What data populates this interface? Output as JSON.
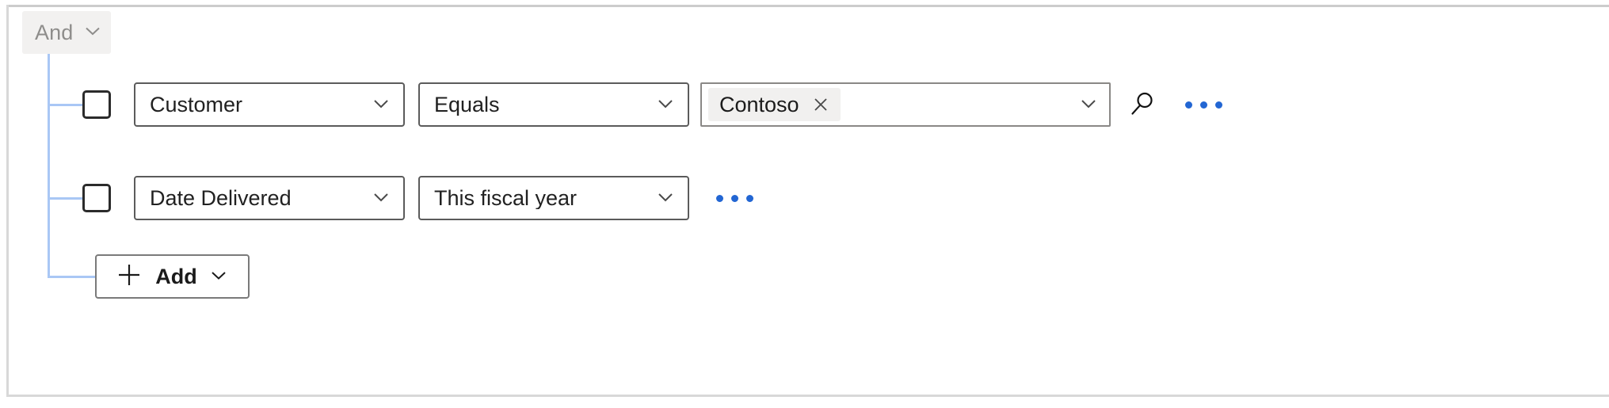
{
  "panel": {
    "group_operator": {
      "label": "And",
      "chevron_icon": "chevron-down-icon"
    },
    "conditions": [
      {
        "select_checkbox": "condition-select-checkbox",
        "attribute": {
          "value": "Customer",
          "chevron_icon": "chevron-down-icon"
        },
        "operator": {
          "value": "Equals",
          "chevron_icon": "chevron-down-icon"
        },
        "value_field": {
          "tags": [
            {
              "label": "Contoso",
              "remove_icon": "close-icon"
            }
          ],
          "chevron_icon": "chevron-down-icon"
        },
        "lookup_icon": "search-icon",
        "overflow_icon": "more-horizontal-icon"
      },
      {
        "select_checkbox": "condition-select-checkbox",
        "attribute": {
          "value": "Date Delivered",
          "chevron_icon": "chevron-down-icon"
        },
        "operator": {
          "value": "This fiscal year",
          "chevron_icon": "chevron-down-icon"
        },
        "overflow_icon": "more-horizontal-icon"
      }
    ],
    "add_button": {
      "label": "Add",
      "plus_icon": "plus-icon",
      "chevron_icon": "chevron-down-icon"
    },
    "colors": {
      "tree_line": "#a9c7f5",
      "overflow_dots": "#2266d3",
      "pill_background": "#f2f1f0",
      "pill_text": "#8e8d8b",
      "tag_background": "#f1f0ef",
      "field_border": "#5b5b5b",
      "panel_border": "#d8d8d8"
    }
  }
}
